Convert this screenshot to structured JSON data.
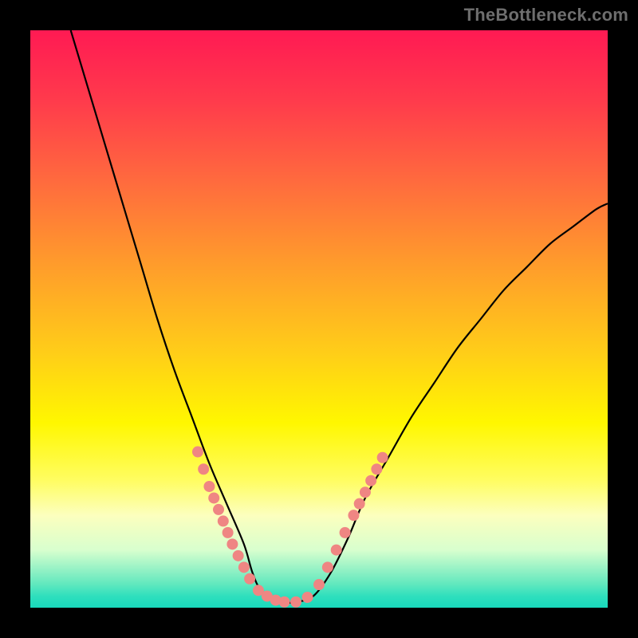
{
  "watermark": {
    "text": "TheBottleneck.com"
  },
  "chart_data": {
    "type": "line",
    "title": "",
    "xlabel": "",
    "ylabel": "",
    "xlim": [
      0,
      100
    ],
    "ylim": [
      0,
      100
    ],
    "grid": false,
    "legend": false,
    "series": [
      {
        "name": "bottleneck-curve",
        "x": [
          7,
          10,
          13,
          16,
          19,
          22,
          25,
          28,
          31,
          34,
          37,
          38.5,
          40,
          43,
          46,
          49,
          52,
          55,
          58,
          62,
          66,
          70,
          74,
          78,
          82,
          86,
          90,
          94,
          98,
          100
        ],
        "values": [
          100,
          90,
          80,
          70,
          60,
          50,
          41,
          33,
          25,
          18,
          11,
          6,
          3,
          1,
          1,
          2,
          6,
          12,
          19,
          26,
          33,
          39,
          45,
          50,
          55,
          59,
          63,
          66,
          69,
          70
        ]
      }
    ],
    "highlight_markers": {
      "name": "marker-dots",
      "color": "#ef8683",
      "points": [
        {
          "x": 29.0,
          "y": 27
        },
        {
          "x": 30.0,
          "y": 24
        },
        {
          "x": 31.0,
          "y": 21
        },
        {
          "x": 31.8,
          "y": 19
        },
        {
          "x": 32.6,
          "y": 17
        },
        {
          "x": 33.4,
          "y": 15
        },
        {
          "x": 34.2,
          "y": 13
        },
        {
          "x": 35.0,
          "y": 11
        },
        {
          "x": 36.0,
          "y": 9
        },
        {
          "x": 37.0,
          "y": 7
        },
        {
          "x": 38.0,
          "y": 5
        },
        {
          "x": 39.5,
          "y": 3
        },
        {
          "x": 41.0,
          "y": 2
        },
        {
          "x": 42.5,
          "y": 1.3
        },
        {
          "x": 44.0,
          "y": 1
        },
        {
          "x": 46.0,
          "y": 1
        },
        {
          "x": 48.0,
          "y": 1.8
        },
        {
          "x": 50.0,
          "y": 4
        },
        {
          "x": 51.5,
          "y": 7
        },
        {
          "x": 53.0,
          "y": 10
        },
        {
          "x": 54.5,
          "y": 13
        },
        {
          "x": 56.0,
          "y": 16
        },
        {
          "x": 57.0,
          "y": 18
        },
        {
          "x": 58.0,
          "y": 20
        },
        {
          "x": 59.0,
          "y": 22
        },
        {
          "x": 60.0,
          "y": 24
        },
        {
          "x": 61.0,
          "y": 26
        }
      ]
    }
  }
}
